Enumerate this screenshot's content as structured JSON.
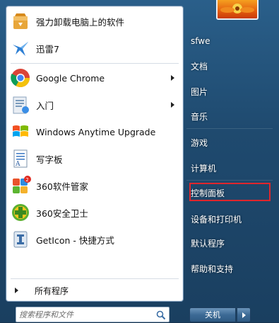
{
  "programs": [
    {
      "label": "强力卸载电脑上的软件",
      "icon": "uninstall-box-icon",
      "has_submenu": false
    },
    {
      "label": "迅雷7",
      "icon": "thunder-bird-icon",
      "has_submenu": false
    },
    {
      "label": "Google Chrome",
      "icon": "chrome-icon",
      "has_submenu": true
    },
    {
      "label": "入门",
      "icon": "getting-started-icon",
      "has_submenu": true
    },
    {
      "label": "Windows Anytime Upgrade",
      "icon": "windows-flag-icon",
      "has_submenu": false
    },
    {
      "label": "写字板",
      "icon": "wordpad-icon",
      "has_submenu": false
    },
    {
      "label": "360软件管家",
      "icon": "360-software-manager-icon",
      "has_submenu": false
    },
    {
      "label": "360安全卫士",
      "icon": "360-safe-guard-icon",
      "has_submenu": false
    },
    {
      "label": "GetIcon - 快捷方式",
      "icon": "geticon-icon",
      "has_submenu": false
    }
  ],
  "all_programs_label": "所有程序",
  "search": {
    "placeholder": "搜索程序和文件"
  },
  "right_items": [
    {
      "label": "sfwe",
      "key": "user"
    },
    {
      "label": "文档",
      "key": "documents"
    },
    {
      "label": "图片",
      "key": "pictures"
    },
    {
      "label": "音乐",
      "key": "music"
    },
    {
      "label": "游戏",
      "key": "games"
    },
    {
      "label": "计算机",
      "key": "computer"
    },
    {
      "label": "控制面板",
      "key": "control-panel"
    },
    {
      "label": "设备和打印机",
      "key": "devices-printers"
    },
    {
      "label": "默认程序",
      "key": "default-programs"
    },
    {
      "label": "帮助和支持",
      "key": "help-support"
    }
  ],
  "shutdown_label": "关机",
  "chrome_badge": "2",
  "colors": {
    "highlight_border": "#e0262c",
    "right_pane_bg": "#2a5f8a",
    "left_pane_bg": "#ffffff"
  }
}
